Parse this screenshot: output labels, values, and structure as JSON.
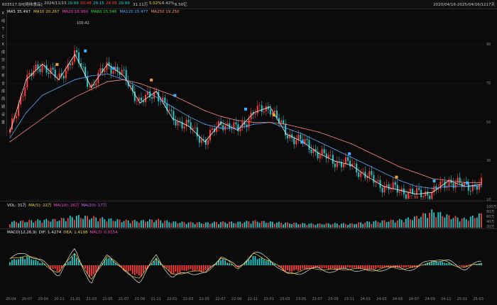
{
  "topbar": {
    "code": "603517.SH[绝味食品]",
    "date": "2024/11/15",
    "open": "29.89",
    "high": "30.48",
    "low": "29.15",
    "close": "29.05",
    "vol": "29.89",
    "change": "31.11万",
    "pct": "5.02%",
    "turnover": "6.42%",
    "amount": "6.50亿",
    "date_range": "2020/04/16-2025/04/16/1217天"
  },
  "leftbar": [
    "K",
    "线",
    "T",
    "C",
    "K",
    "成",
    "交",
    "分",
    "析",
    "合",
    "成",
    "周",
    "期",
    "设",
    "置"
  ],
  "ma_legend": [
    {
      "label": "MA5",
      "value": "35.497",
      "color": "#e8e8e8"
    },
    {
      "label": "MA10",
      "value": "20.267",
      "color": "#f0d040"
    },
    {
      "label": "MA20",
      "value": "16.900",
      "color": "#ff44cc"
    },
    {
      "label": "MA60",
      "value": "15.546",
      "color": "#38d838"
    },
    {
      "label": "MA120",
      "value": "15.477",
      "color": "#5aa8ff"
    },
    {
      "label": "MA250",
      "value": "19.250",
      "color": "#ff8888"
    }
  ],
  "vol_legend": [
    {
      "text": "VOL: 31万",
      "color": "#e8e8e8"
    },
    {
      "text": "MA(5): 22万",
      "color": "#f0d040"
    },
    {
      "text": "MA(10): 26万",
      "color": "#ff44cc"
    },
    {
      "text": "MA(20): 17万",
      "color": "#cc66ff"
    }
  ],
  "macd_legend": [
    {
      "text": "MACD(12,26,9)",
      "color": "#e8e8e8"
    },
    {
      "text": "DIF: 1.4274",
      "color": "#e8e8e8"
    },
    {
      "text": "DEA: 1.4198",
      "color": "#f0d040"
    },
    {
      "text": "MACD: 0.0154",
      "color": "#ff44cc"
    }
  ],
  "price_axis": [
    "90",
    "70",
    "50",
    "30",
    "10"
  ],
  "vol_axis": [
    "100万",
    "80万",
    "60万",
    "40万",
    "20万"
  ],
  "x_axis": [
    "20-04",
    "20-07",
    "20-09",
    "20-11",
    "21-01",
    "21-03",
    "21-05",
    "21-07",
    "21-09",
    "21-11",
    "22-01",
    "22-03",
    "22-05",
    "22-07",
    "22-09",
    "22-11",
    "23-01",
    "23-03",
    "23-05",
    "23-07",
    "23-09",
    "23-11",
    "24-01",
    "24-03",
    "24-05",
    "24-07",
    "24-09",
    "24-11",
    "25-01",
    "25-03"
  ],
  "annotations": {
    "high": "100.42",
    "low": "11.39"
  },
  "colors": {
    "up": "#ff3b3b",
    "down": "#23c8c8",
    "bg": "#0b0b0b"
  },
  "chart_data": {
    "type": "line",
    "title": "",
    "xlabel": "",
    "ylabel": "",
    "ylim": [
      10,
      105
    ],
    "x": [
      "20-04",
      "20-07",
      "20-09",
      "20-11",
      "21-01",
      "21-03",
      "21-05",
      "21-07",
      "21-09",
      "21-11",
      "22-01",
      "22-03",
      "22-05",
      "22-07",
      "22-09",
      "22-11",
      "23-01",
      "23-03",
      "23-05",
      "23-07",
      "23-09",
      "23-11",
      "24-01",
      "24-03",
      "24-05",
      "24-07",
      "24-09",
      "24-11",
      "25-01",
      "25-03"
    ],
    "series": [
      {
        "name": "MA5",
        "values": [
          45,
          72,
          80,
          72,
          85,
          68,
          80,
          74,
          60,
          66,
          52,
          48,
          40,
          50,
          46,
          55,
          58,
          44,
          40,
          34,
          30,
          28,
          22,
          17,
          15,
          13,
          14,
          20,
          17,
          18
        ]
      },
      {
        "name": "MA120",
        "values": [
          42,
          55,
          64,
          68,
          72,
          74,
          75,
          72,
          68,
          63,
          58,
          53,
          49,
          47,
          47,
          49,
          50,
          47,
          44,
          40,
          36,
          32,
          28,
          24,
          20,
          17,
          16,
          17,
          17,
          17
        ]
      },
      {
        "name": "MA250",
        "values": [
          40,
          46,
          52,
          58,
          63,
          67,
          71,
          72,
          70,
          67,
          64,
          60,
          56,
          53,
          51,
          50,
          50,
          49,
          47,
          45,
          42,
          39,
          35,
          31,
          27,
          24,
          21,
          20,
          19,
          19
        ]
      }
    ],
    "volume": [
      30,
      35,
      40,
      42,
      60,
      55,
      45,
      38,
      35,
      42,
      30,
      28,
      25,
      30,
      28,
      35,
      30,
      25,
      22,
      20,
      22,
      20,
      30,
      35,
      40,
      55,
      85,
      60,
      45,
      70
    ],
    "macd": [
      2,
      4,
      1,
      -3,
      5,
      -6,
      4,
      -2,
      -5,
      3,
      -4,
      -2,
      -3,
      3,
      -1,
      4,
      2,
      -3,
      -2,
      -1,
      -2,
      -1,
      -2,
      -1,
      -1,
      -1,
      2,
      1,
      -1,
      1
    ]
  }
}
